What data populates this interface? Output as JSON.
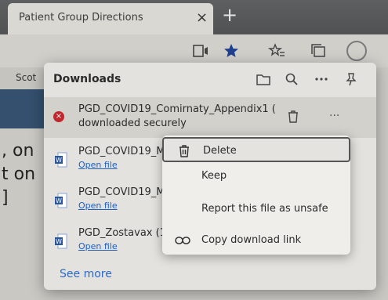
{
  "tab": {
    "title": "Patient Group Directions",
    "close": "×",
    "new_tab": "+"
  },
  "page": {
    "nav_text": "Scot",
    "text_lines": [
      ", on",
      "t on",
      "]"
    ]
  },
  "downloads": {
    "title": "Downloads",
    "see_more": "See more",
    "items": [
      {
        "name": "PGD_COVID19_Comirnaty_Appendix1 (",
        "status": "downloaded securely",
        "state": "error"
      },
      {
        "name": "PGD_COVID19_M",
        "link": "Open file"
      },
      {
        "name": "PGD_COVID19_M",
        "link": "Open file"
      },
      {
        "name": "PGD_Zostavax (1)",
        "link": "Open file"
      }
    ],
    "more_dots": "···"
  },
  "context_menu": {
    "items": [
      {
        "label": "Delete",
        "icon": "trash-icon"
      },
      {
        "label": "Keep",
        "icon": ""
      },
      {
        "label": "Report this file as unsafe",
        "icon": ""
      },
      {
        "label": "Copy download link",
        "icon": "link-icon"
      }
    ]
  },
  "colors": {
    "accent": "#2d6ac8",
    "error": "#c1272d",
    "word": "#2b579a"
  }
}
